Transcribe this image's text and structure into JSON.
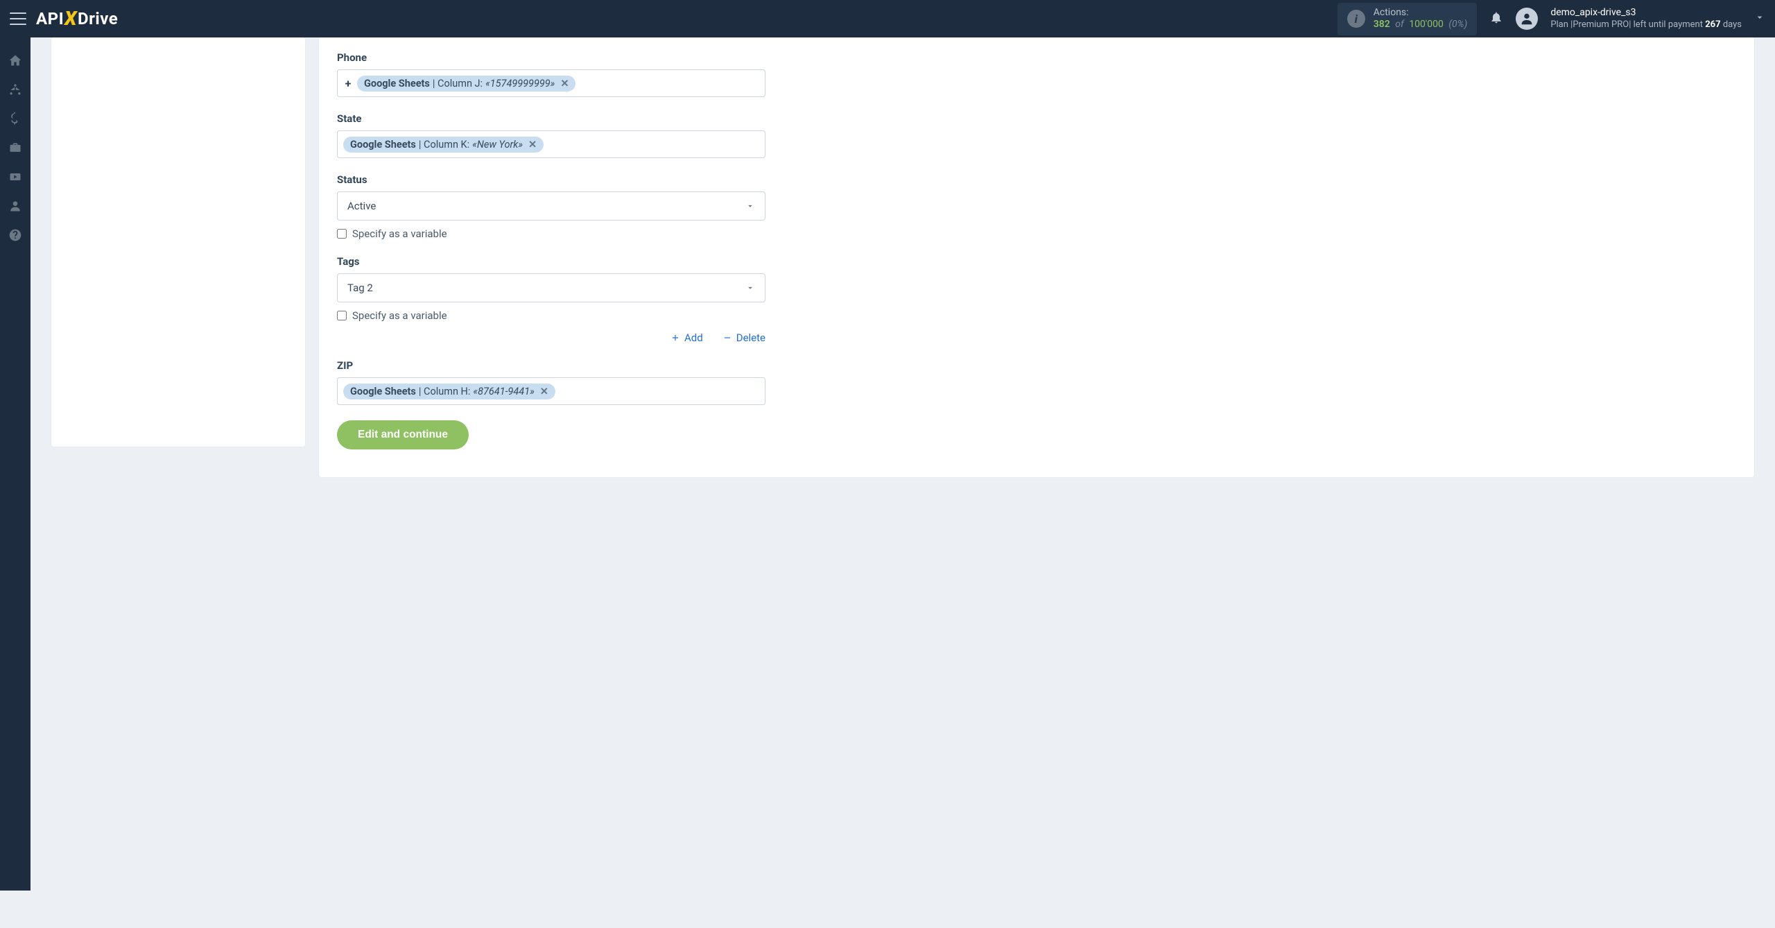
{
  "header": {
    "logo_pre": "API",
    "logo_x": "X",
    "logo_post": "Drive",
    "actions_label": "Actions:",
    "actions_used": "382",
    "actions_of": "of",
    "actions_total": "100'000",
    "actions_pct": "(0%)",
    "username": "demo_apix-drive_s3",
    "plan_prefix": "Plan |",
    "plan_name": "Premium PRO",
    "plan_suffix": "| left until payment ",
    "plan_days": "267",
    "plan_days_word": " days"
  },
  "form": {
    "phone": {
      "label": "Phone",
      "chip_source": "Google Sheets",
      "chip_column": " | Column J: ",
      "chip_value": "«15749999999»"
    },
    "state": {
      "label": "State",
      "chip_source": "Google Sheets",
      "chip_column": " | Column K: ",
      "chip_value": "«New York»"
    },
    "status": {
      "label": "Status",
      "value": "Active",
      "checkbox_label": "Specify as a variable"
    },
    "tags": {
      "label": "Tags",
      "value": "Tag 2",
      "checkbox_label": "Specify as a variable",
      "add_label": "Add",
      "delete_label": "Delete"
    },
    "zip": {
      "label": "ZIP",
      "chip_source": "Google Sheets",
      "chip_column": " | Column H: ",
      "chip_value": "«87641-9441»"
    },
    "submit_label": "Edit and continue"
  }
}
